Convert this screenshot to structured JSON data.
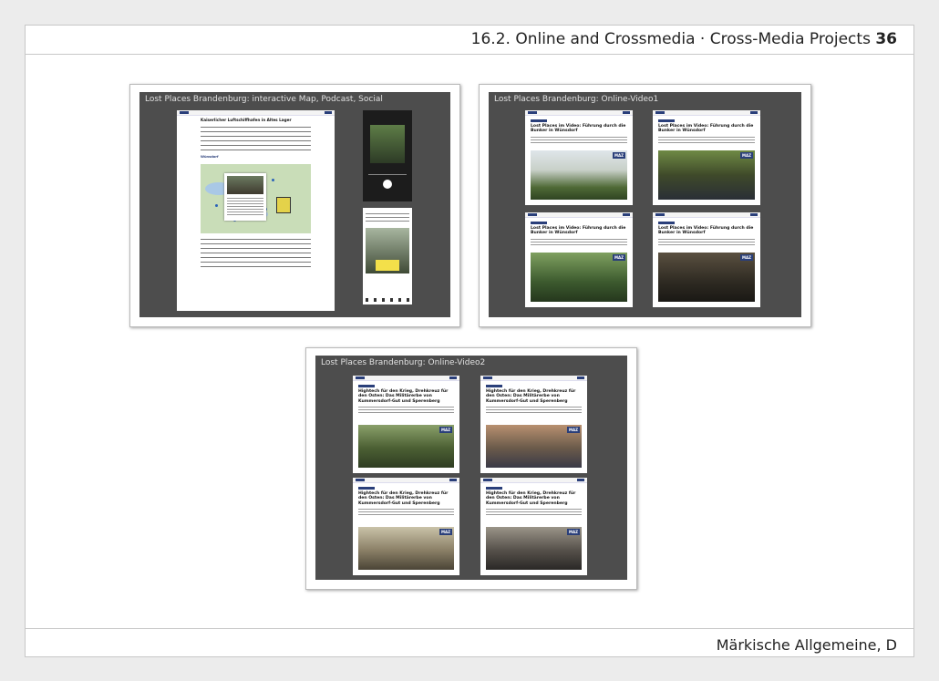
{
  "header": {
    "title": "16.2. Online and Crossmedia · Cross-Media Projects",
    "page": "36"
  },
  "footer": {
    "publisher": "Märkische Allgemeine, D"
  },
  "panels": [
    {
      "title": "Lost Places Brandenburg: interactive Map, Podcast, Social"
    },
    {
      "title": "Lost Places Brandenburg: Online-Video1"
    },
    {
      "title": "Lost Places Brandenburg: Online-Video2"
    }
  ],
  "map_article": {
    "headline": "Kaiserlicher Luftschiffhafen in Altes Lager",
    "map_label": "Wünsdorf"
  },
  "video1_headline": "Lost Places im Video: Führung durch die Bunker in Wünsdorf",
  "video2_headline": "Hightech für den Krieg, Drehkreuz für den Osten: Das Militärerbe von Kummersdorf-Gut und Sperenberg",
  "maz_label": "MAZ"
}
